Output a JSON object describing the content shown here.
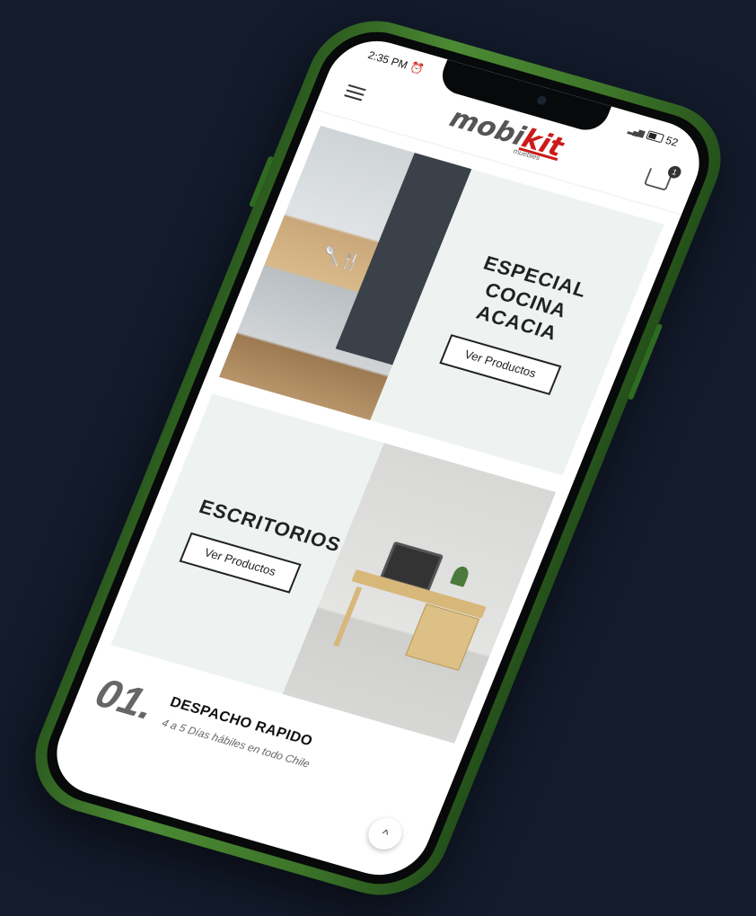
{
  "status_bar": {
    "time": "2:35 PM",
    "battery": "52"
  },
  "header": {
    "logo_main": "mobi",
    "logo_accent": "kit",
    "logo_sub": "muebles",
    "cart_count": "1"
  },
  "banners": [
    {
      "title": "ESPECIAL COCINA ACACIA",
      "button_label": "Ver Productos"
    },
    {
      "title": "ESCRITORIOS",
      "button_label": "Ver Productos"
    }
  ],
  "features": [
    {
      "number": "01.",
      "title": "DESPACHO RAPIDO",
      "subtitle": "4 a 5 Días hábiles en todo Chile"
    }
  ],
  "colors": {
    "background": "#131b2c",
    "phone_frame": "#3c7429",
    "logo_accent": "#cc1a1a"
  }
}
